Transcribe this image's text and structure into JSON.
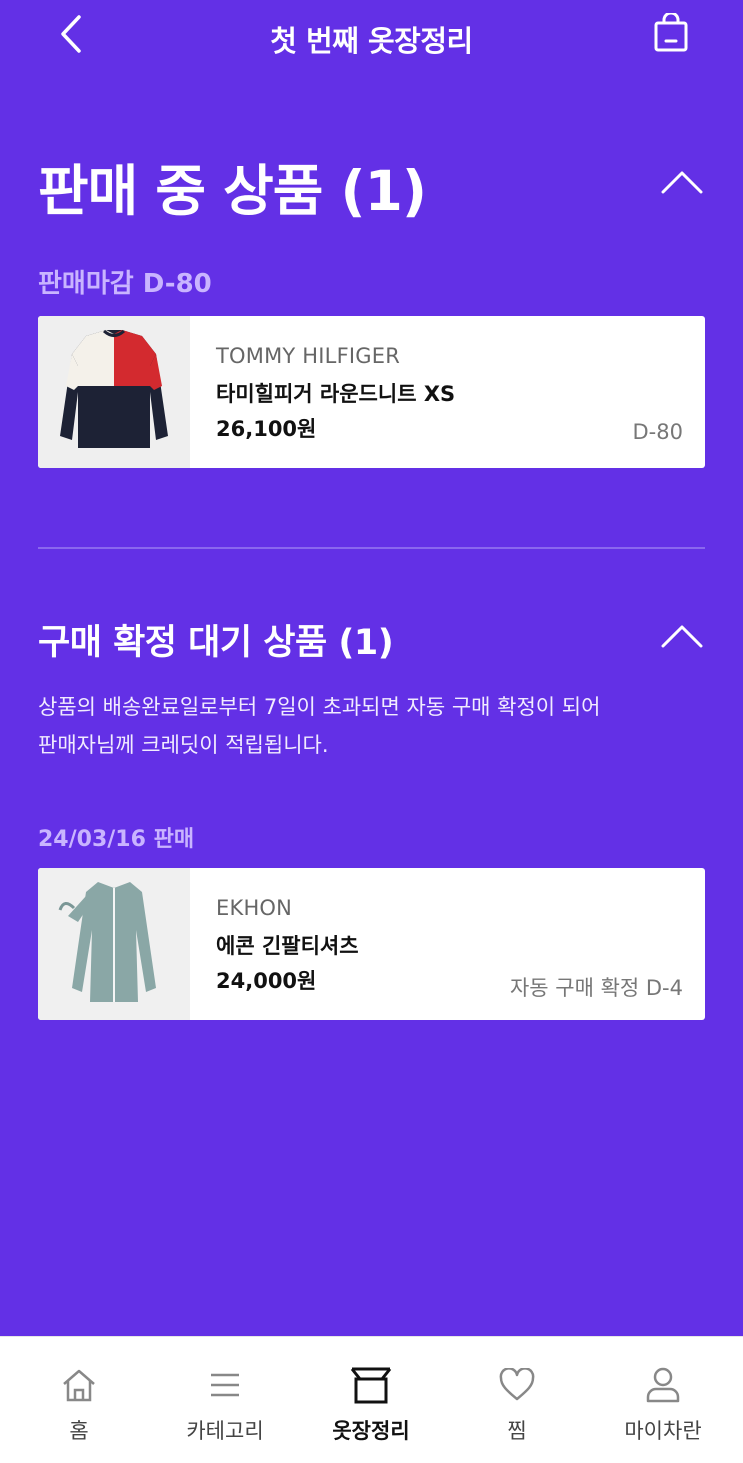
{
  "header": {
    "title": "첫 번째 옷장정리"
  },
  "selling_section": {
    "title": "판매 중 상품 (1)",
    "deadline_label": "판매마감 D-80",
    "items": [
      {
        "brand": "TOMMY HILFIGER",
        "name": "타미힐피거 라운드니트 XS",
        "price": "26,100원",
        "tag": "D-80"
      }
    ]
  },
  "pending_section": {
    "title": "구매 확정 대기 상품 (1)",
    "notice_line1": "상품의 배송완료일로부터 7일이 초과되면 자동 구매 확정이 되어",
    "notice_line2": "판매자님께 크레딧이 적립됩니다.",
    "date_label": "24/03/16 판매",
    "items": [
      {
        "brand": "EKHON",
        "name": "에콘 긴팔티셔츠",
        "price": "24,000원",
        "tag": "자동 구매 확정 D-4"
      }
    ]
  },
  "tabbar": {
    "items": [
      {
        "label": "홈",
        "icon": "home-icon"
      },
      {
        "label": "카테고리",
        "icon": "menu-icon"
      },
      {
        "label": "옷장정리",
        "icon": "closet-box-icon"
      },
      {
        "label": "찜",
        "icon": "heart-icon"
      },
      {
        "label": "마이차란",
        "icon": "user-icon"
      }
    ],
    "active_index": 2
  },
  "colors": {
    "background": "#6330e6",
    "accent_label": "#c9b4ff"
  }
}
